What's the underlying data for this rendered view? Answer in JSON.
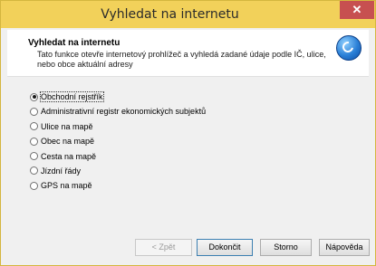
{
  "window": {
    "title": "Vyhledat na internetu",
    "close_label": "✕"
  },
  "header": {
    "title": "Vyhledat na internetu",
    "description": "Tato funkce otevře internetový prohlížeč a vyhledá zadané údaje podle IČ, ulice, nebo obce aktuální adresy",
    "logo_icon": "app-logo-icon"
  },
  "options": [
    {
      "label": "Obchodní rejstřík",
      "selected": true
    },
    {
      "label": "Administrativní registr ekonomických subjektů",
      "selected": false
    },
    {
      "label": "Ulice na mapě",
      "selected": false
    },
    {
      "label": "Obec na mapě",
      "selected": false
    },
    {
      "label": "Cesta na mapě",
      "selected": false
    },
    {
      "label": "Jízdní řády",
      "selected": false
    },
    {
      "label": "GPS na mapě",
      "selected": false
    }
  ],
  "footer": {
    "back_label": "< Zpět",
    "finish_label": "Dokončit",
    "cancel_label": "Storno",
    "help_label": "Nápověda"
  },
  "colors": {
    "titlebar": "#f2d15a",
    "close": "#c75050"
  }
}
